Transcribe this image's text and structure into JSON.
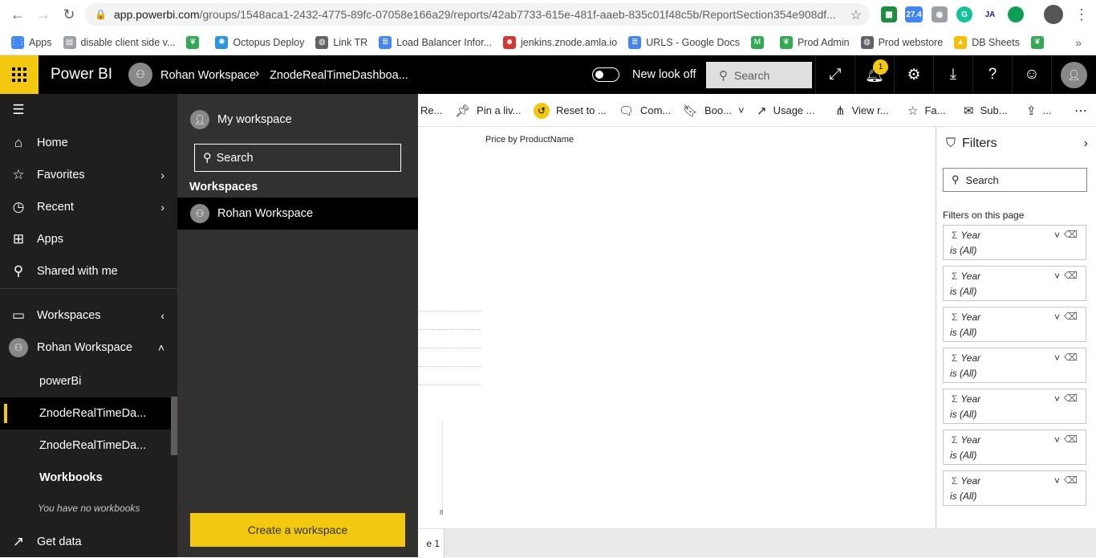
{
  "browser": {
    "url_host": "app.powerbi.com",
    "url_path": "/groups/1548aca1-2432-4775-89fc-07058e166a29/reports/42ab7733-615e-481f-aaeb-835c01f48c5b/ReportSection354e908df...",
    "weather_badge": "27.4",
    "bookmarks": [
      {
        "label": "Apps",
        "icon": "apps-grid-icon",
        "color": "#4285f4"
      },
      {
        "label": "disable client side v...",
        "icon": "page-icon",
        "color": "#9aa0a6"
      },
      {
        "label": "",
        "icon": "leaf-icon",
        "color": "#34a853"
      },
      {
        "label": "Octopus Deploy",
        "icon": "octopus-icon",
        "color": "#2f93e0"
      },
      {
        "label": "Link TR",
        "icon": "globe-icon",
        "color": "#5f6368"
      },
      {
        "label": "Load Balancer Infor...",
        "icon": "docs-icon",
        "color": "#4285f4"
      },
      {
        "label": "jenkins.znode.amla.io",
        "icon": "jenkins-icon",
        "color": "#d33833"
      },
      {
        "label": "URLS - Google Docs",
        "icon": "docs-icon",
        "color": "#4285f4"
      },
      {
        "label": "",
        "icon": "m-icon",
        "color": "#34a853"
      },
      {
        "label": "Prod Admin",
        "icon": "leaf-icon",
        "color": "#34a853"
      },
      {
        "label": "Prod webstore",
        "icon": "globe-icon",
        "color": "#5f6368"
      },
      {
        "label": "DB Sheets",
        "icon": "drive-icon",
        "color": "#fbbc04"
      },
      {
        "label": "",
        "icon": "leaf-icon",
        "color": "#34a853"
      }
    ],
    "more_label": "»"
  },
  "header": {
    "brand": "Power BI",
    "workspace": "Rohan Workspace",
    "report": "ZnodeRealTimeDashboa...",
    "toggle_label": "New look off",
    "search_placeholder": "Search",
    "notification_count": "1",
    "accent": "#f2c811"
  },
  "nav": {
    "items": [
      {
        "label": "Home",
        "icon": "home-icon"
      },
      {
        "label": "Favorites",
        "icon": "star-icon"
      },
      {
        "label": "Recent",
        "icon": "clock-icon"
      },
      {
        "label": "Apps",
        "icon": "apps-icon"
      },
      {
        "label": "Shared with me",
        "icon": "shared-icon"
      },
      {
        "label": "Workspaces",
        "icon": "workspaces-icon"
      },
      {
        "label": "Rohan Workspace",
        "icon": "workspace-avatar-icon"
      }
    ],
    "sub_items": [
      {
        "label": "powerBi"
      },
      {
        "label": "ZnodeRealTimeDa..."
      },
      {
        "label": "ZnodeRealTimeDa..."
      },
      {
        "label": "Workbooks"
      }
    ],
    "workbooks_empty": "You have no workbooks",
    "get_data": "Get data"
  },
  "flyout": {
    "my_workspace": "My workspace",
    "search_placeholder": "Search",
    "section_title": "Workspaces",
    "workspace_item": "Rohan Workspace",
    "create_button": "Create a workspace"
  },
  "actions": [
    {
      "label": "Re...",
      "icon": ""
    },
    {
      "label": "Pin a liv...",
      "icon": "pin-icon"
    },
    {
      "label": "Reset to ...",
      "icon": "reset-icon"
    },
    {
      "label": "Com...",
      "icon": "comment-icon"
    },
    {
      "label": "Boo...",
      "icon": "bookmark-icon"
    },
    {
      "label": "Usage ...",
      "icon": "usage-icon"
    },
    {
      "label": "View r...",
      "icon": "view-related-icon"
    },
    {
      "label": "Fa...",
      "icon": "favorite-icon"
    },
    {
      "label": "Sub...",
      "icon": "subscribe-icon"
    },
    {
      "label": "...",
      "icon": "share-icon"
    }
  ],
  "canvas": {
    "visual_title": "Price by ProductName",
    "axis_tick": "8"
  },
  "page_tab": "e 1",
  "filters": {
    "title": "Filters",
    "search_placeholder": "Search",
    "section": "Filters on this page",
    "cards": [
      {
        "field": "Year",
        "value": "is (All)"
      },
      {
        "field": "Year",
        "value": "is (All)"
      },
      {
        "field": "Year",
        "value": "is (All)"
      },
      {
        "field": "Year",
        "value": "is (All)"
      },
      {
        "field": "Year",
        "value": "is (All)"
      },
      {
        "field": "Year",
        "value": "is (All)"
      },
      {
        "field": "Year",
        "value": "is (All)"
      }
    ]
  }
}
